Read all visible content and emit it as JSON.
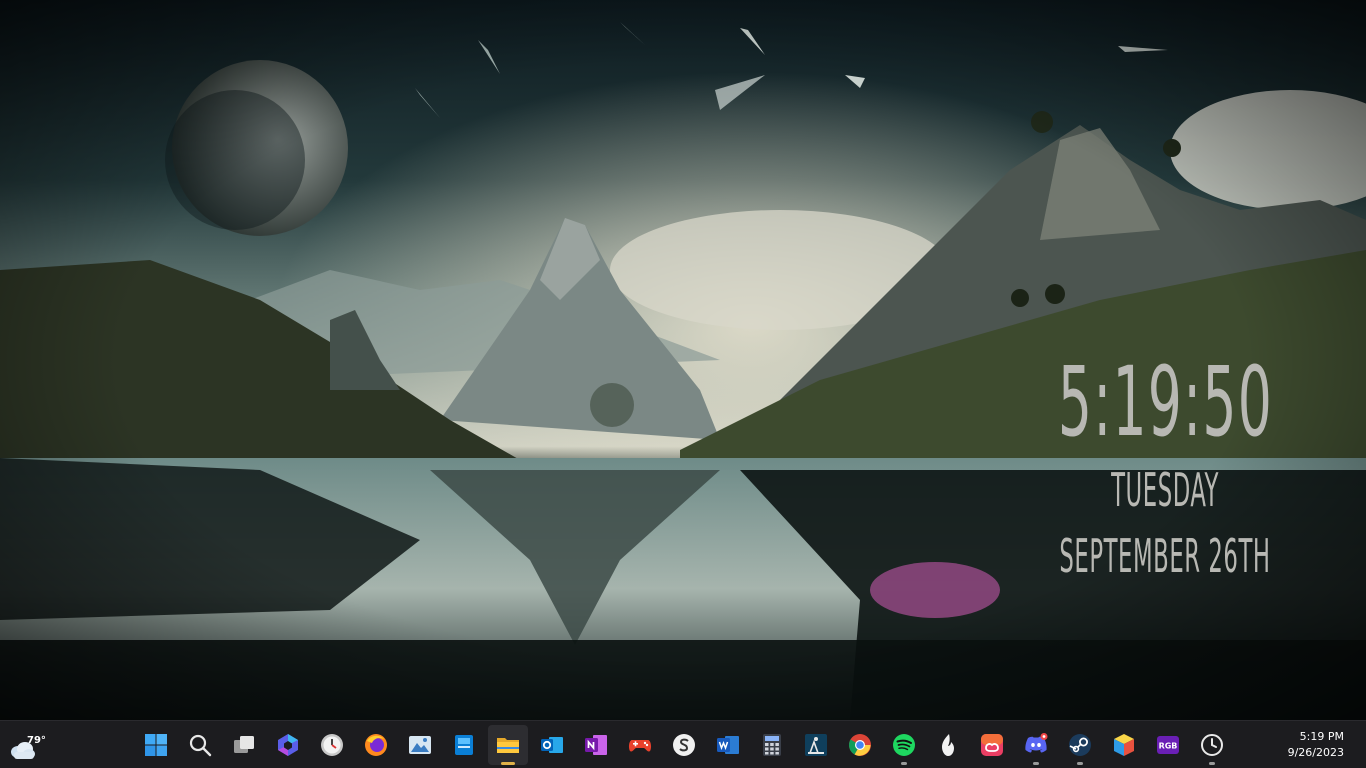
{
  "desktop": {
    "clock_widget": {
      "time": "5:19:50",
      "day": "TUESDAY",
      "date": "SEPTEMBER 26TH"
    }
  },
  "taskbar": {
    "weather": {
      "temperature": "79°",
      "icon": "cloud-icon"
    },
    "apps": [
      {
        "name": "start",
        "icon": "windows-logo-icon",
        "active": false,
        "running": false
      },
      {
        "name": "search",
        "icon": "search-icon",
        "active": false,
        "running": false
      },
      {
        "name": "task-view",
        "icon": "task-view-icon",
        "active": false,
        "running": false
      },
      {
        "name": "copilot",
        "icon": "copilot-icon",
        "active": false,
        "running": false
      },
      {
        "name": "clock-app",
        "icon": "clock-app-icon",
        "active": false,
        "running": false
      },
      {
        "name": "firefox",
        "icon": "firefox-icon",
        "active": false,
        "running": false
      },
      {
        "name": "photos",
        "icon": "photos-icon",
        "active": false,
        "running": false
      },
      {
        "name": "sticky",
        "icon": "blue-app-icon",
        "active": false,
        "running": false
      },
      {
        "name": "file-explorer",
        "icon": "folder-icon",
        "active": true,
        "running": true
      },
      {
        "name": "outlook",
        "icon": "outlook-icon",
        "active": false,
        "running": false
      },
      {
        "name": "onenote",
        "icon": "onenote-icon",
        "active": false,
        "running": false
      },
      {
        "name": "game",
        "icon": "gamepad-icon",
        "active": false,
        "running": false
      },
      {
        "name": "simplenote",
        "icon": "s-circle-icon",
        "active": false,
        "running": false
      },
      {
        "name": "word",
        "icon": "word-icon",
        "active": false,
        "running": false
      },
      {
        "name": "calculator",
        "icon": "calculator-icon",
        "active": false,
        "running": false
      },
      {
        "name": "kindle",
        "icon": "reader-icon",
        "active": false,
        "running": false
      },
      {
        "name": "chrome",
        "icon": "chrome-icon",
        "active": false,
        "running": false
      },
      {
        "name": "spotify",
        "icon": "spotify-icon",
        "active": false,
        "running": true
      },
      {
        "name": "dashlane",
        "icon": "flame-icon",
        "active": false,
        "running": false
      },
      {
        "name": "creative-cloud",
        "icon": "creative-cloud-icon",
        "active": false,
        "running": false
      },
      {
        "name": "discord",
        "icon": "discord-icon",
        "active": false,
        "running": true
      },
      {
        "name": "steam",
        "icon": "steam-icon",
        "active": false,
        "running": true
      },
      {
        "name": "cube-app",
        "icon": "cube-icon",
        "active": false,
        "running": false
      },
      {
        "name": "rgb-app",
        "icon": "rgb-icon",
        "active": false,
        "running": false
      },
      {
        "name": "clock-widget-app",
        "icon": "clock-icon",
        "active": false,
        "running": true
      }
    ],
    "clock": {
      "time": "5:19 PM",
      "date": "9/26/2023"
    }
  },
  "colors": {
    "taskbar_bg": "#1c1c1f",
    "active_indicator": "#e0b24a",
    "clock_text": "#b8b8b3"
  }
}
